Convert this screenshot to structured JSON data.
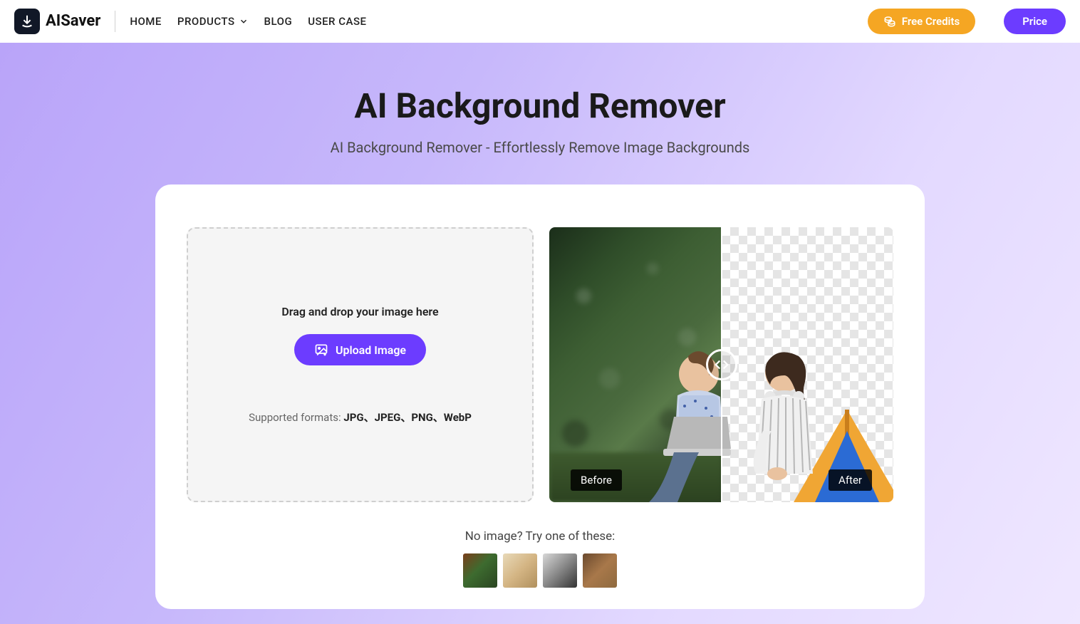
{
  "brand": "AISaver",
  "nav": {
    "home": "HOME",
    "products": "PRODUCTS",
    "blog": "BLOG",
    "usercase": "USER CASE"
  },
  "header": {
    "credits": "Free Credits",
    "price": "Price"
  },
  "hero": {
    "title": "AI Background Remover",
    "subtitle": "AI Background Remover - Effortlessly Remove Image Backgrounds"
  },
  "upload": {
    "drop": "Drag and drop your image here",
    "button": "Upload Image",
    "formats_prefix": "Supported formats: ",
    "formats_bold": "JPG、JPEG、PNG、WebP"
  },
  "preview": {
    "before": "Before",
    "after": "After"
  },
  "samples": {
    "text": "No image? Try one of these:"
  }
}
